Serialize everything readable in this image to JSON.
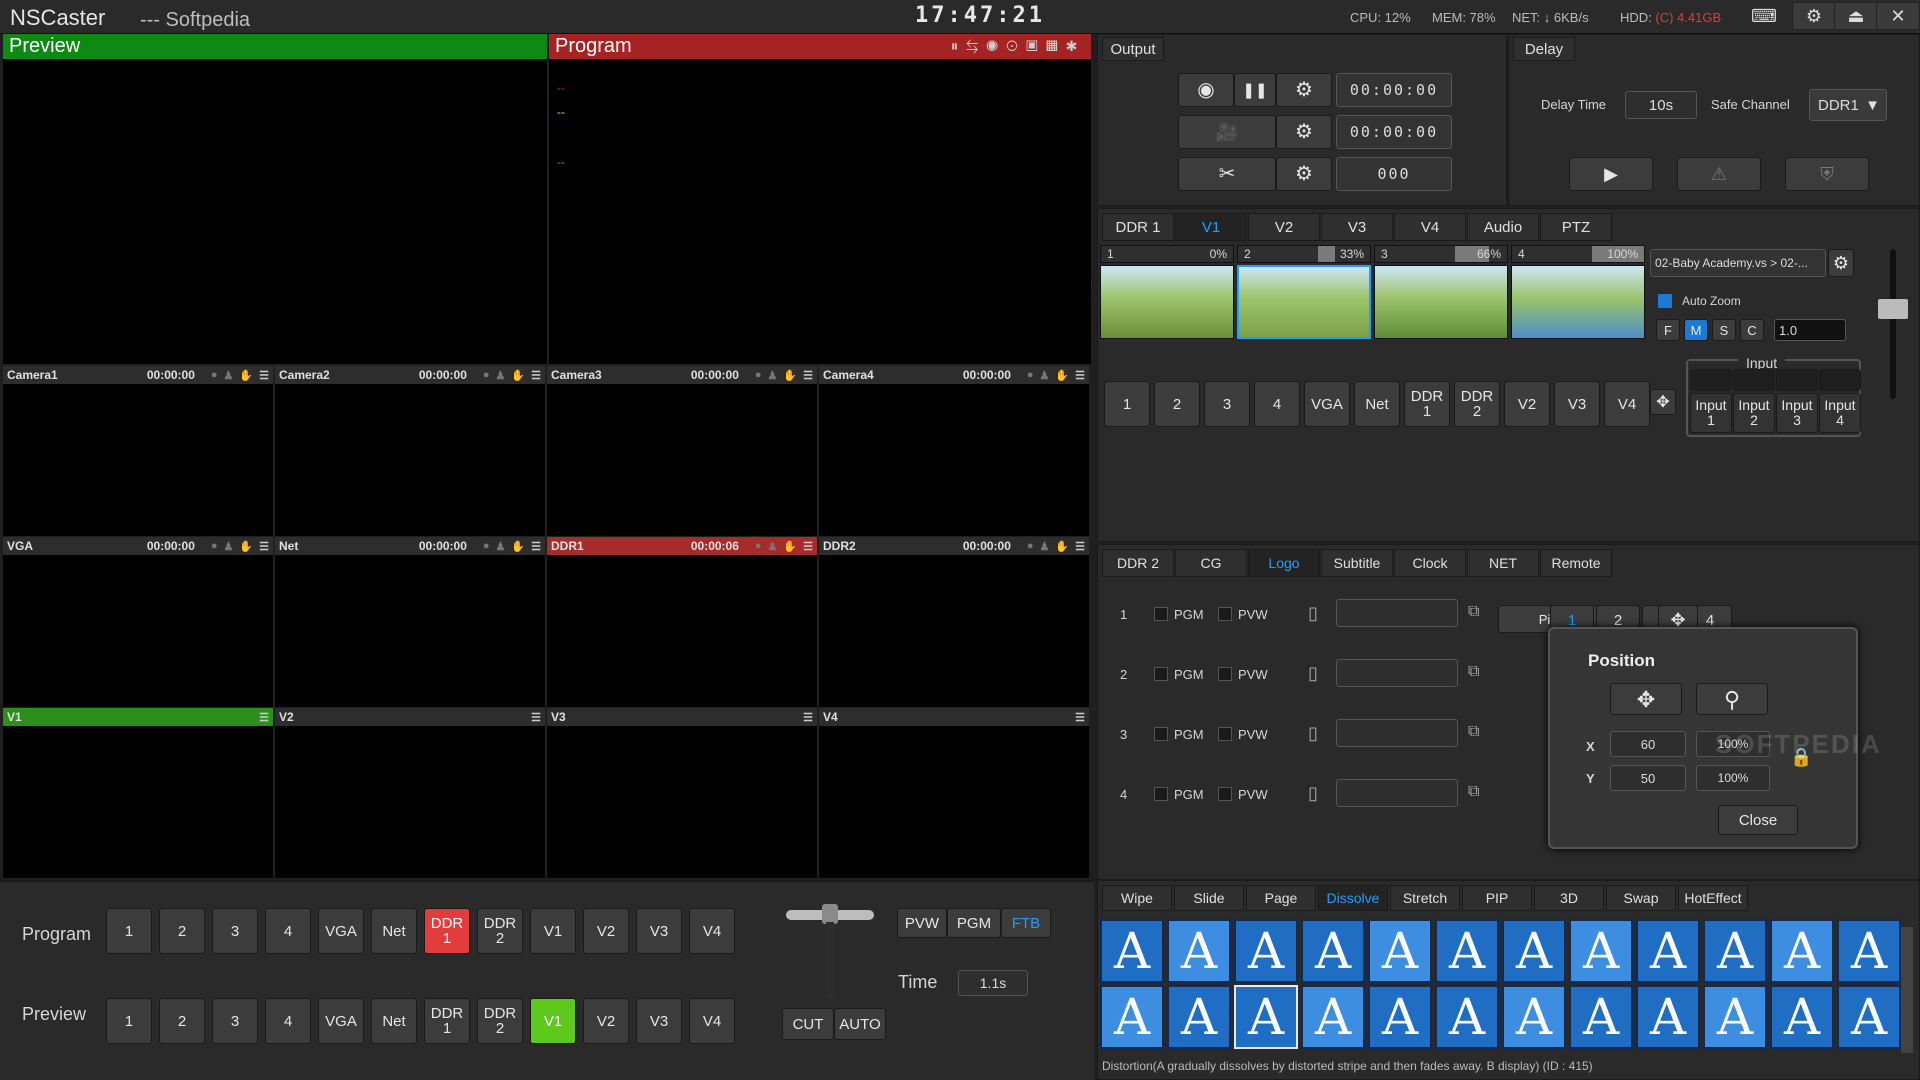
{
  "titlebar": {
    "app_name": "NSCaster",
    "subtitle": "--- Softpedia",
    "clock": "17:47:21",
    "cpu": "CPU: 12%",
    "mem": "MEM: 78%",
    "net": "NET: ↓ 6KB/s",
    "hdd_label": "HDD:",
    "hdd_value": "(C) 4.41GB"
  },
  "preview": {
    "title": "Preview"
  },
  "program": {
    "title": "Program",
    "overlay": [
      "--",
      "--",
      "--"
    ]
  },
  "grid": [
    {
      "label": "Camera1",
      "time": "00:00:00",
      "state": "normal"
    },
    {
      "label": "Camera2",
      "time": "00:00:00",
      "state": "normal"
    },
    {
      "label": "Camera3",
      "time": "00:00:00",
      "state": "normal"
    },
    {
      "label": "Camera4",
      "time": "00:00:00",
      "state": "normal"
    },
    {
      "label": "VGA",
      "time": "00:00:00",
      "state": "normal"
    },
    {
      "label": "Net",
      "time": "00:00:00",
      "state": "normal"
    },
    {
      "label": "DDR1",
      "time": "00:00:06",
      "state": "red"
    },
    {
      "label": "DDR2",
      "time": "00:00:00",
      "state": "normal"
    },
    {
      "label": "V1",
      "time": "",
      "state": "green"
    },
    {
      "label": "V2",
      "time": "",
      "state": "normal"
    },
    {
      "label": "V3",
      "time": "",
      "state": "normal"
    },
    {
      "label": "V4",
      "time": "",
      "state": "normal"
    }
  ],
  "output": {
    "title": "Output",
    "record_time": "00:00:00",
    "stream_time": "00:00:00",
    "snapshot_count": "000"
  },
  "delay": {
    "title": "Delay",
    "delay_time_label": "Delay Time",
    "delay_time_value": "10s",
    "safe_channel_label": "Safe Channel",
    "safe_channel_value": "DDR1"
  },
  "source_tabs": [
    "DDR 1",
    "V1",
    "V2",
    "V3",
    "V4",
    "Audio",
    "PTZ"
  ],
  "source_tabs_active": 1,
  "clips": [
    {
      "index": "1",
      "pct": "0%",
      "progress": 0
    },
    {
      "index": "2",
      "pct": "33%",
      "progress": 0.33
    },
    {
      "index": "3",
      "pct": "66%",
      "progress": 0.66
    },
    {
      "index": "4",
      "pct": "100%",
      "progress": 1.0
    }
  ],
  "clip_file": "02-Baby Academy.vs > 02-...",
  "auto_zoom": "Auto Zoom",
  "zoom_buttons": [
    "F",
    "M",
    "S",
    "C"
  ],
  "zoom_value": "1.0",
  "v_sources": [
    "1",
    "2",
    "3",
    "4",
    "VGA",
    "Net",
    "DDR\n1",
    "DDR\n2",
    "V2",
    "V3",
    "V4"
  ],
  "input_group": {
    "label": "Input",
    "items": [
      "Input\n1",
      "Input\n2",
      "Input\n3",
      "Input\n4"
    ]
  },
  "overlay_tabs": [
    "DDR 2",
    "CG",
    "Logo",
    "Subtitle",
    "Clock",
    "NET",
    "Remote"
  ],
  "overlay_tabs_active": 2,
  "logo_rows": [
    {
      "index": "1",
      "pgm": "PGM",
      "pvw": "PVW"
    },
    {
      "index": "2",
      "pgm": "PGM",
      "pvw": "PVW"
    },
    {
      "index": "3",
      "pgm": "PGM",
      "pvw": "PVW"
    },
    {
      "index": "4",
      "pgm": "PGM",
      "pvw": "PVW"
    }
  ],
  "picture_button": "Picture",
  "logo_pages": [
    "1",
    "2",
    "3",
    "4"
  ],
  "position_popup": {
    "title": "Position",
    "x_label": "X",
    "x_value": "60",
    "x_scale": "100%",
    "y_label": "Y",
    "y_value": "50",
    "y_scale": "100%",
    "close": "Close"
  },
  "transition_tabs": [
    "Wipe",
    "Slide",
    "Page",
    "Dissolve",
    "Stretch",
    "PIP",
    "3D",
    "Swap",
    "HotEffect"
  ],
  "transition_tabs_active": 3,
  "effect_glyph": "A",
  "effect_description": "Distortion(A gradually dissolves by distorted stripe and then fades away. B display) (ID : 415)",
  "watermark": "SOFTPEDIA",
  "bus": {
    "program_label": "Program",
    "preview_label": "Preview",
    "buttons": [
      "1",
      "2",
      "3",
      "4",
      "VGA",
      "Net",
      "DDR\n1",
      "DDR\n2",
      "V1",
      "V2",
      "V3",
      "V4"
    ],
    "program_active": 6,
    "preview_active": 8
  },
  "transition": {
    "pvw": "PVW",
    "pgm": "PGM",
    "ftb": "FTB",
    "time_label": "Time",
    "time_value": "1.1s",
    "cut": "CUT",
    "auto": "AUTO"
  },
  "colors": {
    "preview_bar": "#0c8a14",
    "program_bar": "#a52323",
    "accent_blue": "#1aa0ff",
    "alert_red": "#e23c3c",
    "active_green": "#5ec81c"
  }
}
